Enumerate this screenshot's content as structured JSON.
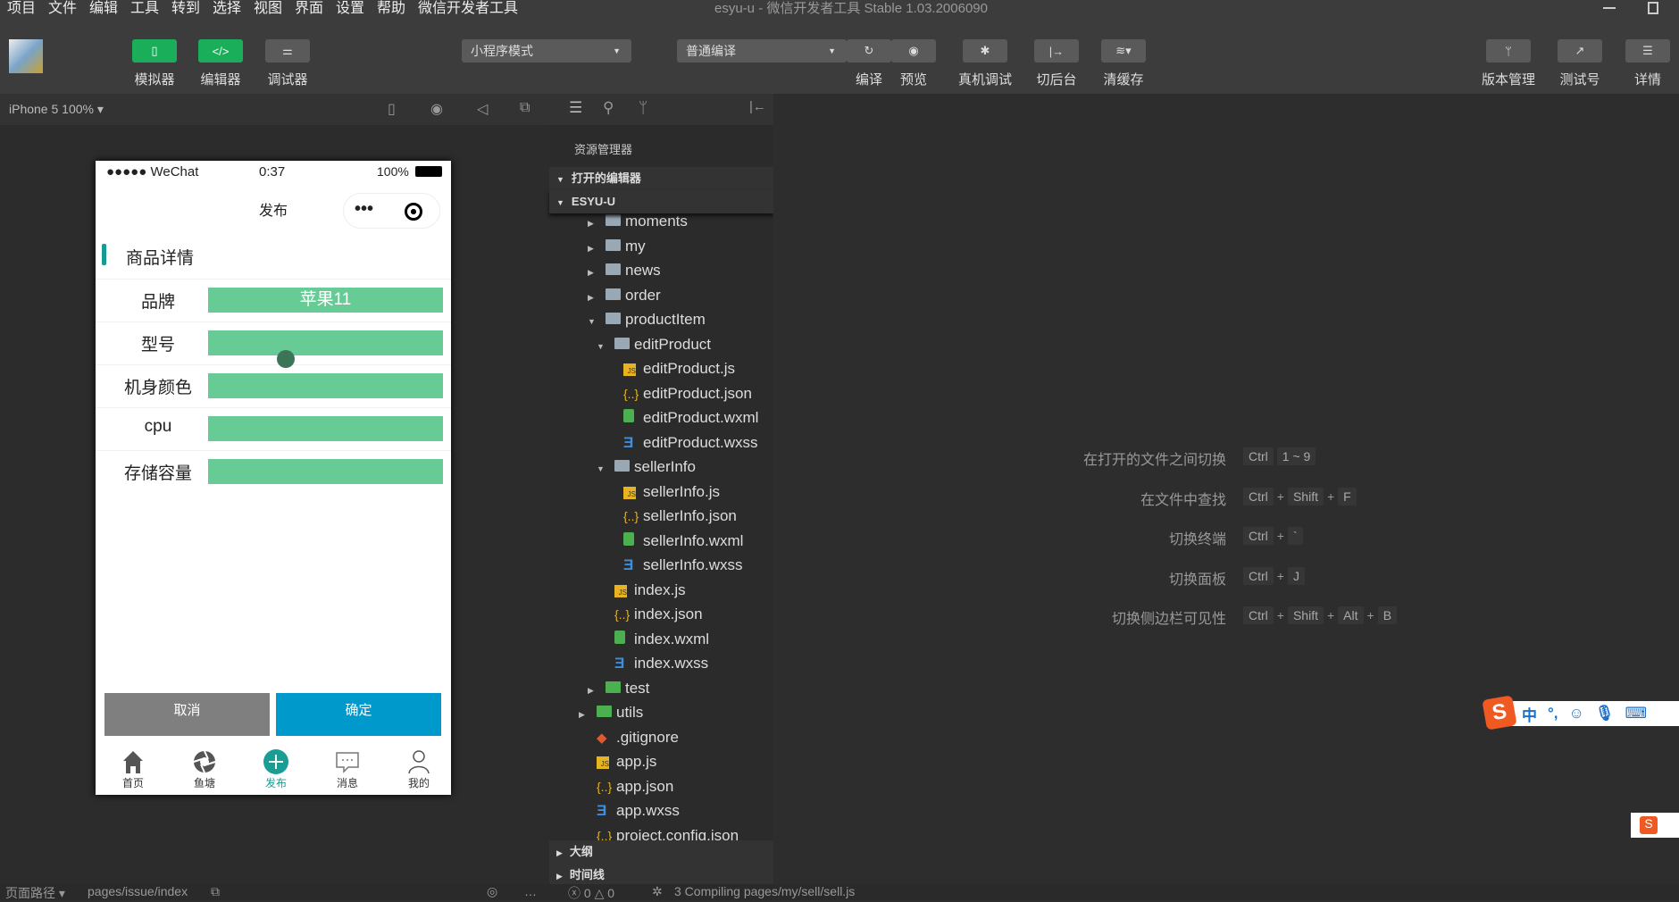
{
  "menu": [
    "项目",
    "文件",
    "编辑",
    "工具",
    "转到",
    "选择",
    "视图",
    "界面",
    "设置",
    "帮助",
    "微信开发者工具"
  ],
  "window_title": "esyu-u - 微信开发者工具 Stable 1.03.2006090",
  "toolbar": {
    "simulator": "模拟器",
    "editor": "编辑器",
    "debugger": "调试器",
    "mode": "小程序模式",
    "compile_mode": "普通编译",
    "compile": "编译",
    "preview": "预览",
    "remote_debug": "真机调试",
    "background": "切后台",
    "clear_cache": "清缓存",
    "version": "版本管理",
    "test_account": "测试号",
    "details": "详情"
  },
  "simulator": {
    "device": "iPhone 5 100%"
  },
  "phone": {
    "carrier": "●●●●● WeChat",
    "time": "0:37",
    "battery": "100%",
    "nav_title": "发布",
    "section_title": "商品详情",
    "fields": [
      {
        "label": "品牌",
        "value": "苹果11"
      },
      {
        "label": "型号",
        "value": ""
      },
      {
        "label": "机身颜色",
        "value": ""
      },
      {
        "label": "cpu",
        "value": ""
      },
      {
        "label": "存储容量",
        "value": ""
      }
    ],
    "cancel": "取消",
    "confirm": "确定",
    "tabs": [
      {
        "label": "首页",
        "icon": "home-icon"
      },
      {
        "label": "鱼塘",
        "icon": "aperture-icon"
      },
      {
        "label": "发布",
        "icon": "plus-circle-icon"
      },
      {
        "label": "消息",
        "icon": "message-icon"
      },
      {
        "label": "我的",
        "icon": "user-icon"
      }
    ],
    "accent": "#67cb96",
    "confirm_color": "#0099cc",
    "active_tab_color": "#1a9d94"
  },
  "explorer": {
    "title": "资源管理器",
    "open_editors": "打开的编辑器",
    "project": "ESYU-U",
    "outline": "大纲",
    "timeline": "时间线",
    "tree": [
      {
        "name": "moments",
        "type": "folder",
        "depth": 1,
        "open": false
      },
      {
        "name": "my",
        "type": "folder",
        "depth": 1,
        "open": false
      },
      {
        "name": "news",
        "type": "folder",
        "depth": 1,
        "open": false
      },
      {
        "name": "order",
        "type": "folder",
        "depth": 1,
        "open": false
      },
      {
        "name": "productItem",
        "type": "folder",
        "depth": 1,
        "open": true
      },
      {
        "name": "editProduct",
        "type": "folder",
        "depth": 2,
        "open": true
      },
      {
        "name": "editProduct.js",
        "type": "js",
        "depth": 3
      },
      {
        "name": "editProduct.json",
        "type": "json",
        "depth": 3
      },
      {
        "name": "editProduct.wxml",
        "type": "wxml",
        "depth": 3
      },
      {
        "name": "editProduct.wxss",
        "type": "wxss",
        "depth": 3
      },
      {
        "name": "sellerInfo",
        "type": "folder",
        "depth": 2,
        "open": true
      },
      {
        "name": "sellerInfo.js",
        "type": "js",
        "depth": 3
      },
      {
        "name": "sellerInfo.json",
        "type": "json",
        "depth": 3
      },
      {
        "name": "sellerInfo.wxml",
        "type": "wxml",
        "depth": 3
      },
      {
        "name": "sellerInfo.wxss",
        "type": "wxss",
        "depth": 3
      },
      {
        "name": "index.js",
        "type": "js",
        "depth": 2
      },
      {
        "name": "index.json",
        "type": "json",
        "depth": 2
      },
      {
        "name": "index.wxml",
        "type": "wxml",
        "depth": 2
      },
      {
        "name": "index.wxss",
        "type": "wxss",
        "depth": 2
      },
      {
        "name": "test",
        "type": "folder-special",
        "depth": 1,
        "open": false
      },
      {
        "name": "utils",
        "type": "folder-special",
        "depth": 0,
        "open": false
      },
      {
        "name": ".gitignore",
        "type": "git",
        "depth": 0
      },
      {
        "name": "app.js",
        "type": "js",
        "depth": 0
      },
      {
        "name": "app.json",
        "type": "json",
        "depth": 0
      },
      {
        "name": "app.wxss",
        "type": "wxss",
        "depth": 0
      },
      {
        "name": "project.config.json",
        "type": "json",
        "depth": 0
      }
    ]
  },
  "shortcuts": [
    {
      "label": "在打开的文件之间切换",
      "keys": [
        "Ctrl",
        "1 ~ 9"
      ],
      "plus": false
    },
    {
      "label": "在文件中查找",
      "keys": [
        "Ctrl",
        "Shift",
        "F"
      ],
      "plus": true
    },
    {
      "label": "切换终端",
      "keys": [
        "Ctrl",
        "`"
      ],
      "plus": true
    },
    {
      "label": "切换面板",
      "keys": [
        "Ctrl",
        "J"
      ],
      "plus": true
    },
    {
      "label": "切换侧边栏可见性",
      "keys": [
        "Ctrl",
        "Shift",
        "Alt",
        "B"
      ],
      "plus": true
    }
  ],
  "ime": {
    "lang": "中",
    "punct": "°,"
  },
  "status": {
    "page_path_label": "页面路径",
    "page_path": "pages/issue/index",
    "errors": "0",
    "warnings": "0",
    "compile": "3 Compiling pages/my/sell/sell.js"
  }
}
